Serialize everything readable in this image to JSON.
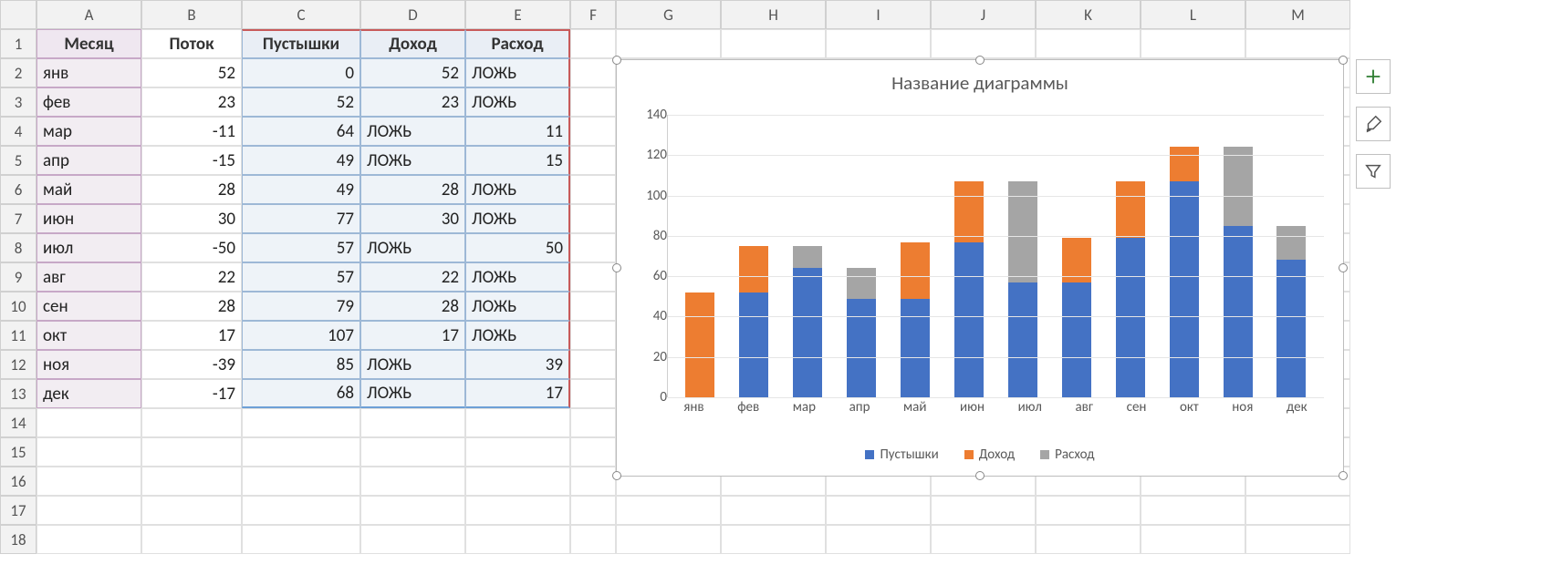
{
  "columns": [
    "A",
    "B",
    "C",
    "D",
    "E",
    "F",
    "G",
    "H",
    "I",
    "J",
    "K",
    "L",
    "M"
  ],
  "row_headers": [
    "1",
    "2",
    "3",
    "4",
    "5",
    "6",
    "7",
    "8",
    "9",
    "10",
    "11",
    "12",
    "13",
    "14",
    "15",
    "16",
    "17",
    "18"
  ],
  "table": {
    "headers": {
      "a": "Месяц",
      "b": "Поток",
      "c": "Пустышки",
      "d": "Доход",
      "e": "Расход"
    },
    "rows": [
      {
        "a": "янв",
        "b": "52",
        "c": "0",
        "d": "52",
        "e": "ЛОЖЬ"
      },
      {
        "a": "фев",
        "b": "23",
        "c": "52",
        "d": "23",
        "e": "ЛОЖЬ"
      },
      {
        "a": "мар",
        "b": "-11",
        "c": "64",
        "d": "ЛОЖЬ",
        "e": "11"
      },
      {
        "a": "апр",
        "b": "-15",
        "c": "49",
        "d": "ЛОЖЬ",
        "e": "15"
      },
      {
        "a": "май",
        "b": "28",
        "c": "49",
        "d": "28",
        "e": "ЛОЖЬ"
      },
      {
        "a": "июн",
        "b": "30",
        "c": "77",
        "d": "30",
        "e": "ЛОЖЬ"
      },
      {
        "a": "июл",
        "b": "-50",
        "c": "57",
        "d": "ЛОЖЬ",
        "e": "50"
      },
      {
        "a": "авг",
        "b": "22",
        "c": "57",
        "d": "22",
        "e": "ЛОЖЬ"
      },
      {
        "a": "сен",
        "b": "28",
        "c": "79",
        "d": "28",
        "e": "ЛОЖЬ"
      },
      {
        "a": "окт",
        "b": "17",
        "c": "107",
        "d": "17",
        "e": "ЛОЖЬ"
      },
      {
        "a": "ноя",
        "b": "-39",
        "c": "85",
        "d": "ЛОЖЬ",
        "e": "39"
      },
      {
        "a": "дек",
        "b": "-17",
        "c": "68",
        "d": "ЛОЖЬ",
        "e": "17"
      }
    ]
  },
  "chart_data": {
    "type": "bar",
    "stacked": true,
    "title": "Название диаграммы",
    "xlabel": "",
    "ylabel": "",
    "ylim": [
      0,
      140
    ],
    "yticks": [
      0,
      20,
      40,
      60,
      80,
      100,
      120,
      140
    ],
    "categories": [
      "янв",
      "фев",
      "мар",
      "апр",
      "май",
      "июн",
      "июл",
      "авг",
      "сен",
      "окт",
      "ноя",
      "дек"
    ],
    "series": [
      {
        "name": "Пустышки",
        "color": "#4472c4",
        "values": [
          0,
          52,
          64,
          49,
          49,
          77,
          57,
          57,
          79,
          107,
          85,
          68
        ]
      },
      {
        "name": "Доход",
        "color": "#ed7d31",
        "values": [
          52,
          23,
          0,
          0,
          28,
          30,
          0,
          22,
          28,
          17,
          0,
          0
        ]
      },
      {
        "name": "Расход",
        "color": "#a5a5a5",
        "values": [
          0,
          0,
          11,
          15,
          0,
          0,
          50,
          0,
          0,
          0,
          39,
          17
        ]
      }
    ],
    "legend": [
      "Пустышки",
      "Доход",
      "Расход"
    ]
  },
  "tools": {
    "add": "add-chart-element",
    "brush": "chart-styles",
    "filter": "chart-filter"
  }
}
